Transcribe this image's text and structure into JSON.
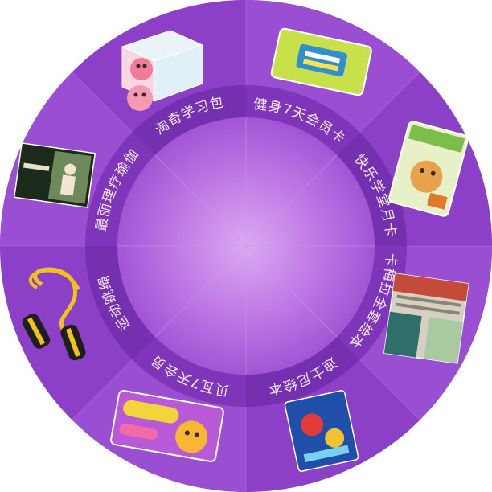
{
  "wheel": {
    "colors": {
      "outer_light": "#9b4fd0",
      "outer_dark": "#8a3fc4",
      "ring_band": "#7b32b5",
      "inner_center": "#d9a3f0",
      "inner_edge": "#a65ad6",
      "divider": "#b67ee2"
    },
    "prizes": [
      {
        "label": "健身7天会员卡",
        "icon": "fitness-card-icon"
      },
      {
        "label": "快乐学堂月卡",
        "icon": "storybook-card-icon"
      },
      {
        "label": "卡梅拉全套绘本",
        "icon": "picture-book-set-icon"
      },
      {
        "label": "迪士尼绘本",
        "icon": "disney-book-icon"
      },
      {
        "label": "贝瓦7天会员",
        "icon": "beva-card-icon"
      },
      {
        "label": "运动跳绳",
        "icon": "jump-rope-icon"
      },
      {
        "label": "最丽理疗瑜伽",
        "icon": "yoga-book-icon"
      },
      {
        "label": "淘奇学习包",
        "icon": "learning-box-icon"
      }
    ]
  }
}
